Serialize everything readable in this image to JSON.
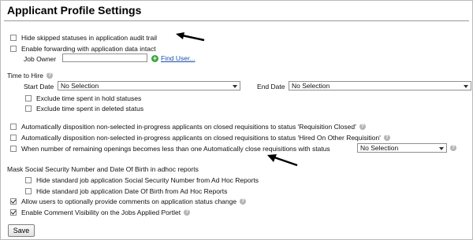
{
  "page": {
    "title": "Applicant Profile Settings"
  },
  "options": {
    "hide_skipped": {
      "label": "Hide skipped statuses in application audit trail",
      "checked": false
    },
    "enable_forwarding": {
      "label": "Enable forwarding with application data intact",
      "checked": false
    },
    "job_owner": {
      "label": "Job Owner",
      "value": "",
      "find_user_label": "Find User..."
    }
  },
  "time_to_hire": {
    "label": "Time to Hire",
    "start_date": {
      "label": "Start Date",
      "selected": "No Selection"
    },
    "end_date": {
      "label": "End Date",
      "selected": "No Selection"
    },
    "exclude_hold": {
      "label": "Exclude time spent in hold statuses",
      "checked": false
    },
    "exclude_deleted": {
      "label": "Exclude time spent in deleted status",
      "checked": false
    }
  },
  "auto_disposition": {
    "closed": {
      "label": "Automatically disposition non-selected in-progress applicants on closed requisitions to status 'Requisition Closed'",
      "checked": false
    },
    "hired_other": {
      "label": "Automatically disposition non-selected in-progress applicants on closed requisitions to status 'Hired On Other Requisition'",
      "checked": false
    },
    "auto_close": {
      "label": "When number of remaining openings becomes less than one Automatically close requisitions with status",
      "checked": false,
      "selected": "No Selection"
    }
  },
  "mask_ssn": {
    "label": "Mask Social Security Number and Date Of Birth in adhoc reports",
    "hide_ssn": {
      "label": "Hide standard job application Social Security Number from Ad Hoc Reports",
      "checked": false
    },
    "hide_dob": {
      "label": "Hide standard job application Date Of Birth from Ad Hoc Reports",
      "checked": false
    }
  },
  "comments": {
    "allow_comments": {
      "label": "Allow users to optionally provide comments on application status change",
      "checked": true
    },
    "comment_visibility": {
      "label": "Enable Comment Visibility on the Jobs Applied Portlet",
      "checked": true
    }
  },
  "footer": {
    "save_label": "Save"
  },
  "icons": {
    "help": "help-icon",
    "add": "add-user-icon",
    "arrow": "annotation-arrow-icon"
  }
}
